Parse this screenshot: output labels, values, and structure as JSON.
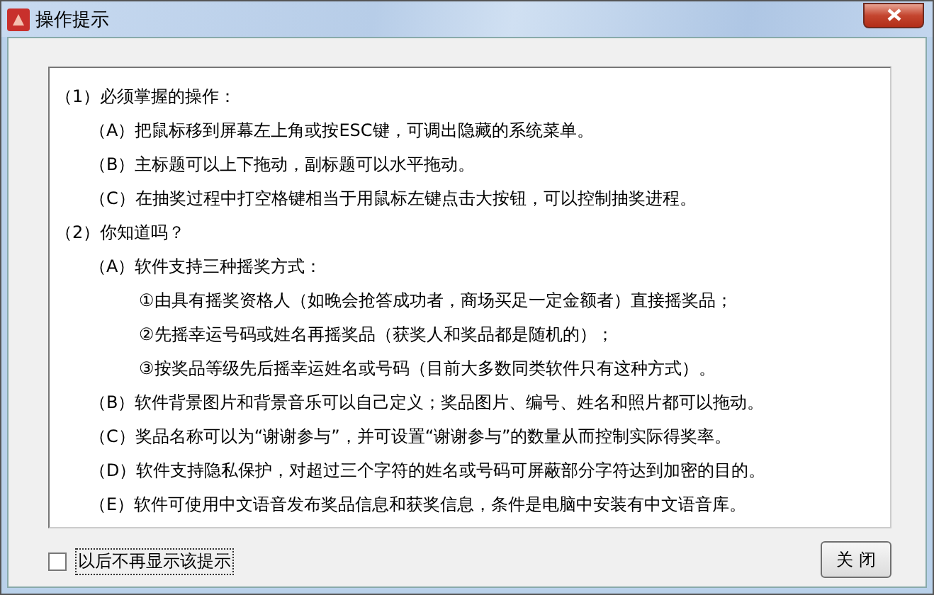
{
  "window": {
    "title": "操作提示"
  },
  "tips": [
    {
      "text": "（1）必须掌握的操作：",
      "children": [
        {
          "text": "（A）把鼠标移到屏幕左上角或按ESC键，可调出隐藏的系统菜单。"
        },
        {
          "text": "（B）主标题可以上下拖动，副标题可以水平拖动。"
        },
        {
          "text": "（C）在抽奖过程中打空格键相当于用鼠标左键点击大按钮，可以控制抽奖进程。"
        }
      ]
    },
    {
      "text": "（2）你知道吗？",
      "children": [
        {
          "text": "（A）软件支持三种摇奖方式：",
          "children": [
            {
              "text": "①由具有摇奖资格人（如晚会抢答成功者，商场买足一定金额者）直接摇奖品；"
            },
            {
              "text": "②先摇幸运号码或姓名再摇奖品（获奖人和奖品都是随机的）；"
            },
            {
              "text": "③按奖品等级先后摇幸运姓名或号码（目前大多数同类软件只有这种方式）。"
            }
          ]
        },
        {
          "text": "（B）软件背景图片和背景音乐可以自己定义；奖品图片、编号、姓名和照片都可以拖动。"
        },
        {
          "text": "（C）奖品名称可以为“谢谢参与”，并可设置“谢谢参与”的数量从而控制实际得奖率。"
        },
        {
          "text": "（D）软件支持隐私保护，对超过三个字符的姓名或号码可屏蔽部分字符达到加密的目的。"
        },
        {
          "text": "（E）软件可使用中文语音发布奖品信息和获奖信息，条件是电脑中安装有中文语音库。"
        }
      ]
    }
  ],
  "dont_show_again": {
    "label": "以后不再显示该提示",
    "checked": false
  },
  "buttons": [
    "关 闭"
  ]
}
